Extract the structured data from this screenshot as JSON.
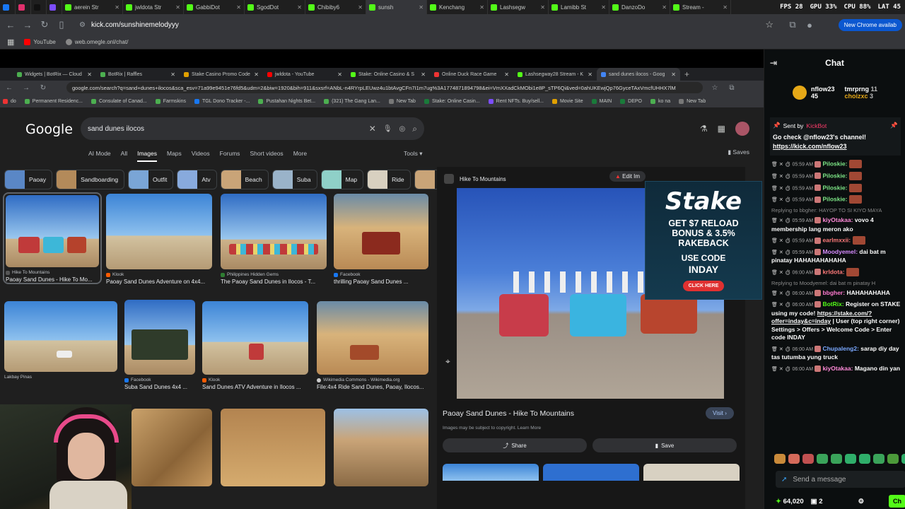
{
  "outer_tabs": [
    {
      "label": "",
      "color": "#1877f2"
    },
    {
      "label": "",
      "color": "#e1306c"
    },
    {
      "label": "",
      "color": "#111111"
    },
    {
      "label": "",
      "color": "#7c4dff"
    },
    {
      "label": "aerein Str",
      "color": "#53fc18"
    },
    {
      "label": "jwldota Str",
      "color": "#53fc18"
    },
    {
      "label": "GabbiDot",
      "color": "#53fc18"
    },
    {
      "label": "SgodDot",
      "color": "#53fc18"
    },
    {
      "label": "Chibiby6",
      "color": "#53fc18"
    },
    {
      "label": "sunsh",
      "color": "#53fc18",
      "active": true
    },
    {
      "label": "Kenchang",
      "color": "#53fc18"
    },
    {
      "label": "Lashsegw",
      "color": "#53fc18"
    },
    {
      "label": "Lamibb St",
      "color": "#53fc18"
    },
    {
      "label": "DanzoDo",
      "color": "#53fc18"
    },
    {
      "label": "Stream -",
      "color": "#53fc18"
    }
  ],
  "stats": {
    "fps": "FPS 28",
    "gpu": "GPU 33%",
    "cpu": "CPU 88%",
    "lat": "LAT 45"
  },
  "outer_url": "kick.com/sunshinemelodyyy",
  "new_chrome": "New Chrome availab",
  "outer_bookmarks": [
    {
      "label": "YouTube",
      "color": "#ff0000"
    },
    {
      "label": "web.omegle.onl/chat/",
      "color": "#888888"
    }
  ],
  "inner_tabs": [
    {
      "label": "Widgets | BotRix — Cloud"
    },
    {
      "label": "BotRix | Raffles"
    },
    {
      "label": "Stake Casino Promo Code"
    },
    {
      "label": "jwldota - YouTube"
    },
    {
      "label": "Stake: Online Casino & S"
    },
    {
      "label": "Online Duck Race Game"
    },
    {
      "label": "Lashsegway28 Stream - K"
    },
    {
      "label": "sand dunes ilocos - Goog",
      "active": true
    }
  ],
  "inner_url": "google.com/search?q=sand+dunes+ilocos&sca_esv=71a99e9451e76fd5&udm=2&biw=1920&bih=911&sxsrf=ANbL-n4RYrpLEUwz4u1btAvgCFn7I1m7ug%3A1774871894798&ei=VmXXadCkMObi1e8P_sTP6Qi&ved=0ahUKEwjQp76GyceTAxVmcfUHHX7lM",
  "inner_bookmarks": [
    "do",
    "Permanent Residenc...",
    "Consulate of Canad...",
    "Farmskins",
    "TGL Dono Tracker -...",
    "Pustahan Nights Bet...",
    "(321) The Gang Lan...",
    "New Tab",
    "Stake: Online Casin...",
    "Rent NFTs. Buy/sell...",
    "Movie Site",
    "MAIN",
    "DEPO",
    "ko na",
    "New Tab"
  ],
  "google": {
    "logo": "Google",
    "query": "sand dunes ilocos",
    "nav": [
      "AI Mode",
      "All",
      "Images",
      "Maps",
      "Videos",
      "Forums",
      "Short videos",
      "More"
    ],
    "tools": "Tools",
    "saves": "Saves",
    "chips": [
      "Paoay",
      "Sandboarding",
      "Outfit",
      "Atv",
      "Beach",
      "Suba",
      "Map",
      "Ride",
      "Phot"
    ],
    "results": [
      {
        "src": "Hike To Mountains",
        "title": "Paoay Sand Dunes - Hike To Mo..."
      },
      {
        "src": "Klook",
        "title": "Paoay Sand Dunes Adventure on 4x4..."
      },
      {
        "src": "Philippines Hidden Gems",
        "title": "The Paoay Sand Dunes in Ilocos - T..."
      },
      {
        "src": "Facebook",
        "title": "thrilling Paoay Sand Dunes ..."
      },
      {
        "src": "Lakbay Pinas",
        "title": ""
      },
      {
        "src": "Facebook",
        "title": "Suba Sand Dunes 4x4 ..."
      },
      {
        "src": "Klook",
        "title": "Sand Dunes ATV Adventure in Ilocos ..."
      },
      {
        "src": "Wikimedia Commons - Wikimedia.org",
        "title": "File:4x4 Ride Sand Dunes, Paoay, Ilocos..."
      }
    ]
  },
  "panel": {
    "source": "Hike To Mountains",
    "edit": "Edit Im",
    "caption": "Paoay Sand Dunes - Hike To Mountains",
    "copyright": "Images may be subject to copyright. Learn More",
    "visit": "Visit",
    "share": "Share",
    "save": "Save"
  },
  "stake_ad": {
    "logo": "Stake",
    "line1": "GET $7 RELOAD",
    "line2": "BONUS & 3.5%",
    "line3": "RAKEBACK",
    "use": "USE CODE",
    "code": "INDAY",
    "button": "CLICK HERE"
  },
  "chat": {
    "title": "Chat",
    "top_gifters": [
      {
        "name": "nflow23",
        "count": "45"
      },
      {
        "name": "tmrprng",
        "count": "11"
      },
      {
        "name": "choizxc",
        "count": "3"
      }
    ],
    "pinned": {
      "sent_by": "Sent by",
      "sender": "KickBot",
      "message": "Go check @nflow23's channel!",
      "link": "https://kick.com/nflow23"
    },
    "messages": [
      {
        "time": "05:59 AM",
        "user": "Piloskie:",
        "color": "#7ee787",
        "text": ""
      },
      {
        "time": "05:59 AM",
        "user": "Piloskie:",
        "color": "#7ee787",
        "text": ""
      },
      {
        "time": "05:59 AM",
        "user": "Piloskie:",
        "color": "#7ee787",
        "text": ""
      },
      {
        "time": "05:59 AM",
        "user": "Piloskie:",
        "color": "#7ee787",
        "text": ""
      },
      {
        "reply": "Replying to bbgher: HAYOP TO SI KIYO MAYA"
      },
      {
        "time": "05:59 AM",
        "user": "kiyOtakaa:",
        "color": "#ff8ad8",
        "text": "vovo 4 membership lang meron ako"
      },
      {
        "time": "05:59 AM",
        "user": "earlmxxii:",
        "color": "#ff7a7a",
        "text": ""
      },
      {
        "time": "05:59 AM",
        "user": "Moodyemel:",
        "color": "#d68bff",
        "text": "dai bat m pinatay HAHAHAHAHAHA"
      },
      {
        "time": "06:00 AM",
        "user": "krldota:",
        "color": "#ff7a7a",
        "text": ""
      },
      {
        "reply": "Replying to Moodyemel: dai bat m pinatay H"
      },
      {
        "time": "06:00 AM",
        "user": "bbgher:",
        "color": "#ff7ad0",
        "text": "HAHAHAHAHA"
      },
      {
        "time": "06:00 AM",
        "user": "BotRix:",
        "color": "#53fc18",
        "text": "Register on STAKE using my code!",
        "link": "https://stake.com/?offer=inday&c=inday",
        "extra": "| User (top right corner) Settings > Offers > Welcome Code > Enter code INDAY"
      },
      {
        "time": "06:00 AM",
        "user": "Chupaleng2:",
        "color": "#7aa8ff",
        "text": "sarap diy day tas tutumba yung truck"
      },
      {
        "time": "06:00 AM",
        "user": "kiyOtakaa:",
        "color": "#ff8ad8",
        "text": "Magano din yan"
      }
    ],
    "placeholder": "Send a message",
    "points": "64,020",
    "viewers": "2",
    "chat_button": "Ch"
  }
}
